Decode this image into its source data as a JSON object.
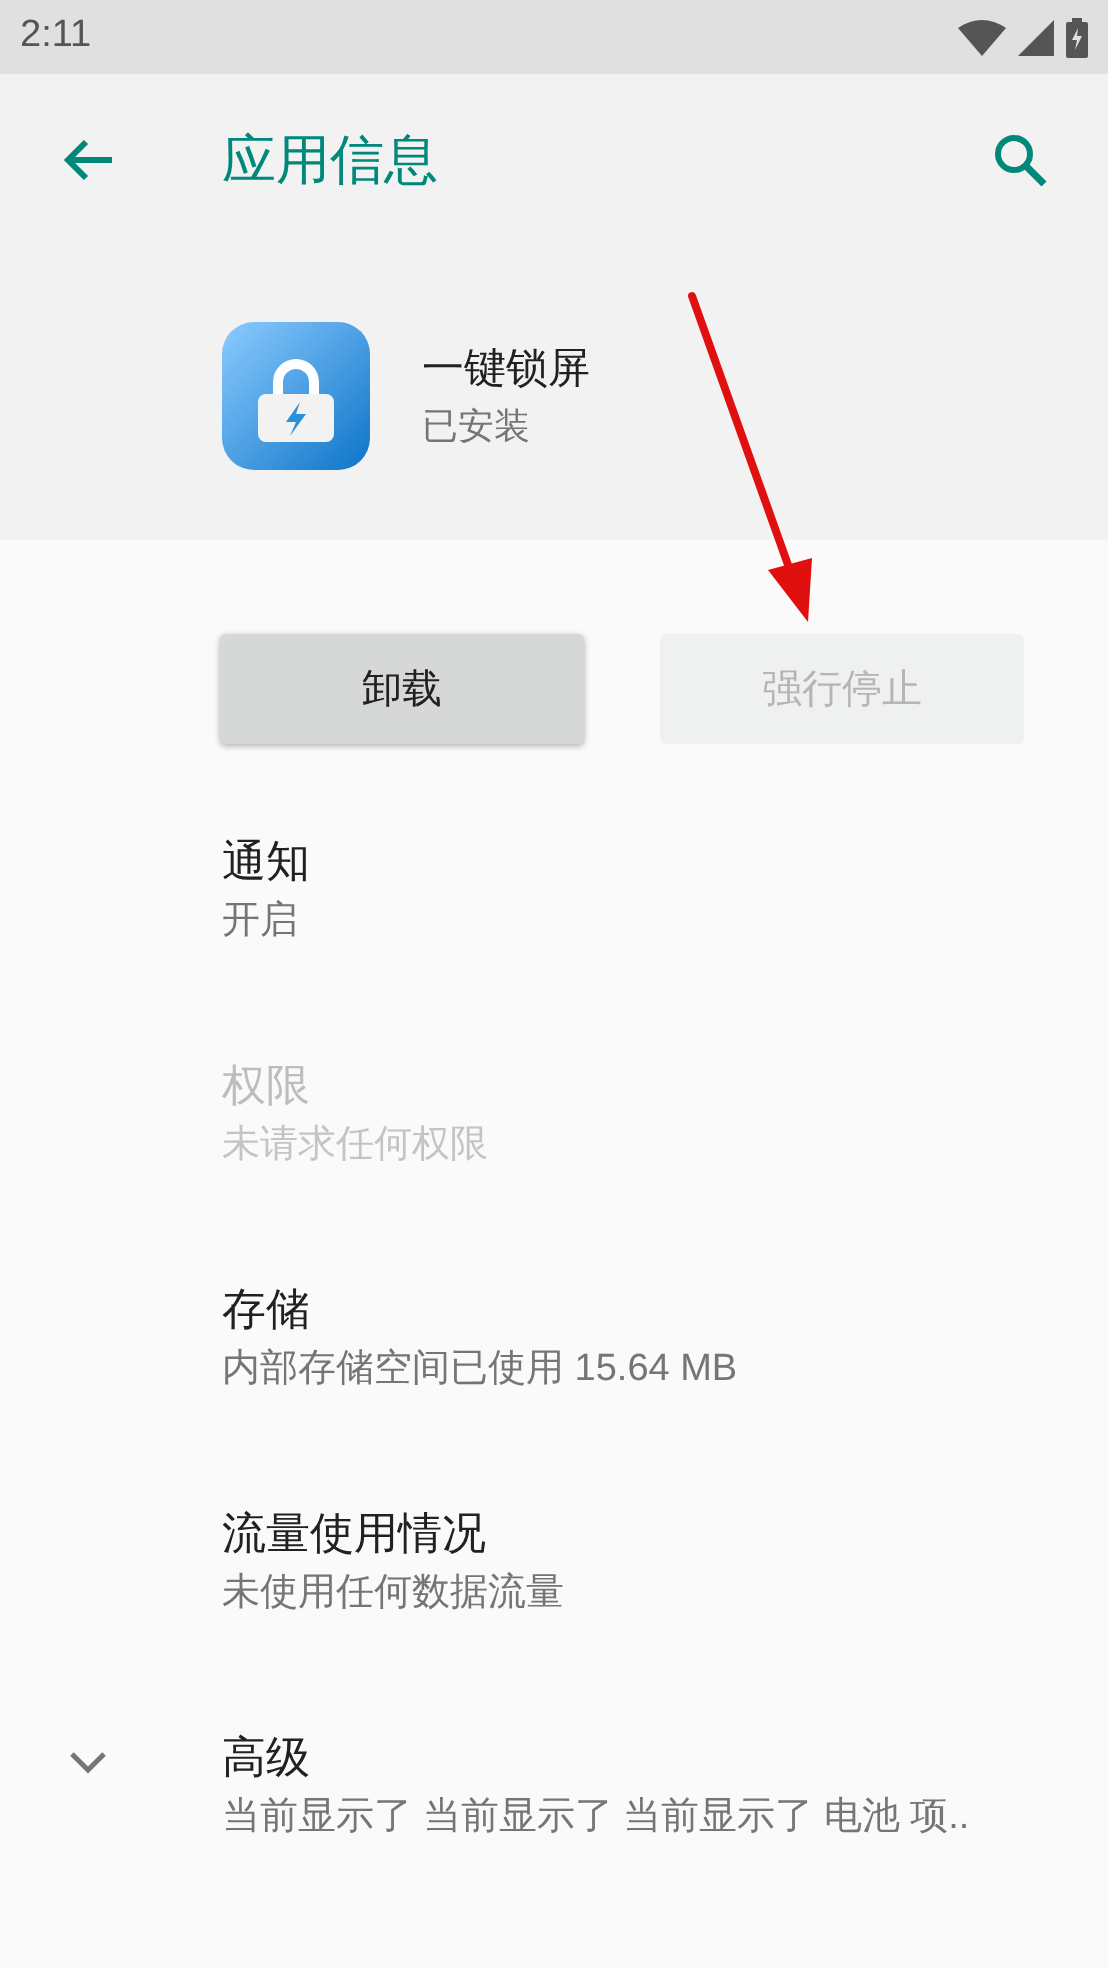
{
  "status_bar": {
    "time": "2:11"
  },
  "toolbar": {
    "title": "应用信息"
  },
  "app": {
    "name": "一键锁屏",
    "status": "已安装"
  },
  "buttons": [
    {
      "label": "卸载",
      "disabled": false
    },
    {
      "label": "强行停止",
      "disabled": true
    }
  ],
  "settings": [
    {
      "kind": "plain",
      "title": "通知",
      "summary": "开启",
      "disabled": false
    },
    {
      "kind": "plain",
      "title": "权限",
      "summary": "未请求任何权限",
      "disabled": true
    },
    {
      "kind": "plain",
      "title": "存储",
      "summary": "内部存储空间已使用 15.64 MB",
      "disabled": false
    },
    {
      "kind": "plain",
      "title": "流量使用情况",
      "summary": "未使用任何数据流量",
      "disabled": false
    },
    {
      "kind": "expandable",
      "title": "高级",
      "summary": "当前显示了 当前显示了 当前显示了 电池 项..",
      "disabled": false
    }
  ]
}
